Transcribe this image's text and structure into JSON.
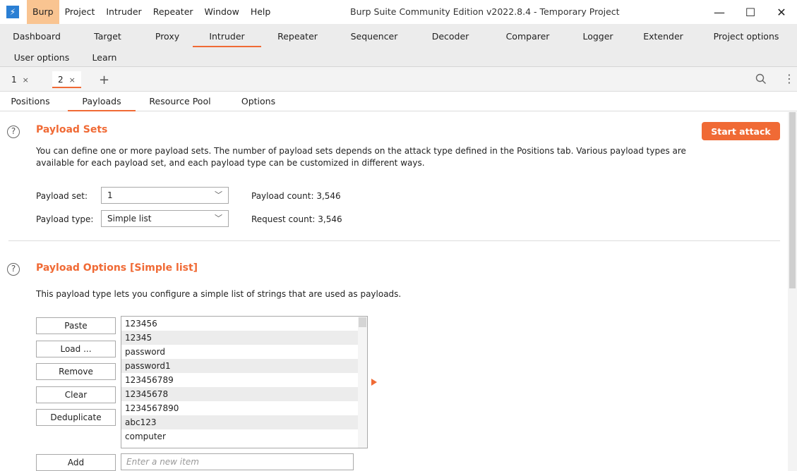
{
  "app": {
    "icon_glyph": "⚡",
    "window_title": "Burp Suite Community Edition v2022.8.4 - Temporary Project",
    "menu": [
      "Burp",
      "Project",
      "Intruder",
      "Repeater",
      "Window",
      "Help"
    ],
    "window_controls": {
      "minimize": "—",
      "maximize": "☐",
      "close": "✕"
    }
  },
  "tool_tabs_row1": [
    "Dashboard",
    "Target",
    "Proxy",
    "Intruder",
    "Repeater",
    "Sequencer",
    "Decoder",
    "Comparer",
    "Logger",
    "Extender",
    "Project options"
  ],
  "tool_tabs_row2": [
    "User options",
    "Learn"
  ],
  "instance_tabs": [
    {
      "label": "1",
      "close": "×"
    },
    {
      "label": "2",
      "close": "×"
    }
  ],
  "add_tab_glyph": "+",
  "more_glyph": "⋮",
  "sub_tabs": [
    "Positions",
    "Payloads",
    "Resource Pool",
    "Options"
  ],
  "payload_sets": {
    "help_glyph": "?",
    "title": "Payload Sets",
    "start_attack": "Start attack",
    "description_line1": "You can define one or more payload sets. The number of payload sets depends on the attack type defined in the Positions tab. Various payload types are",
    "description_line2": "available for each payload set, and each payload type can be customized in different ways.",
    "payload_set_label": "Payload set:",
    "payload_set_value": "1",
    "payload_type_label": "Payload type:",
    "payload_type_value": "Simple list",
    "payload_count": "Payload count: 3,546",
    "request_count": "Request count: 3,546",
    "chevron": "﹀"
  },
  "payload_options": {
    "help_glyph": "?",
    "title": "Payload Options [Simple list]",
    "description": "This payload type lets you configure a simple list of strings that are used as payloads.",
    "buttons": {
      "paste": "Paste",
      "load": "Load ...",
      "remove": "Remove",
      "clear": "Clear",
      "deduplicate": "Deduplicate",
      "add": "Add"
    },
    "items": [
      "123456",
      "12345",
      "password",
      "password1",
      "123456789",
      "12345678",
      "1234567890",
      "abc123",
      "computer"
    ],
    "add_placeholder": "Enter a new item"
  },
  "colors": {
    "accent": "#f06a35",
    "menu_active": "#f9c491"
  },
  "icons": [
    "burp-app-icon",
    "search-icon",
    "more-vertical-icon",
    "help-icon",
    "chevron-down-icon",
    "arrow-right-icon"
  ]
}
